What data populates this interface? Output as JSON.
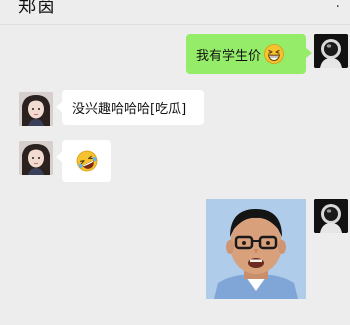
{
  "header": {
    "title": "郑茵",
    "more_label": "·"
  },
  "messages": [
    {
      "sender": "me",
      "type": "text",
      "text": "我有学生价",
      "emoji": "grinning-squint-emoji"
    },
    {
      "sender": "other",
      "type": "text",
      "text": "没兴趣哈哈哈[吃瓜]"
    },
    {
      "sender": "other",
      "type": "emoji",
      "emoji": "rolling-laughing-emoji"
    },
    {
      "sender": "me",
      "type": "sticker",
      "sticker": "man-with-glasses-sticker"
    }
  ],
  "colors": {
    "background": "#ededed",
    "my_bubble": "#95ec69",
    "their_bubble": "#ffffff",
    "text": "#111111"
  }
}
